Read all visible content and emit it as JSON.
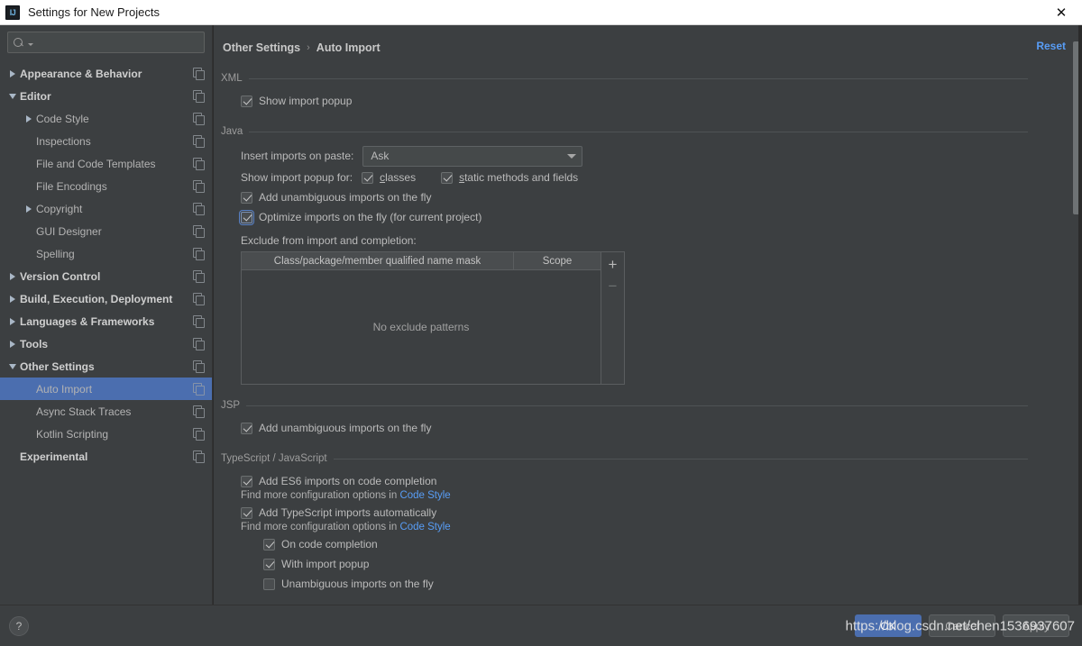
{
  "window": {
    "title": "Settings for New Projects",
    "app_icon": "intellij-idea-icon",
    "close_icon": "close-icon"
  },
  "sidebar": {
    "search": {
      "placeholder": "",
      "value": "",
      "icon": "search-icon"
    },
    "items": [
      {
        "label": "Appearance & Behavior",
        "level": 0,
        "twisty": "closed",
        "selected": false,
        "copy_icon": true
      },
      {
        "label": "Editor",
        "level": 0,
        "twisty": "open",
        "selected": false,
        "copy_icon": true
      },
      {
        "label": "Code Style",
        "level": 1,
        "twisty": "closed",
        "selected": false,
        "copy_icon": true
      },
      {
        "label": "Inspections",
        "level": 1,
        "twisty": "none",
        "selected": false,
        "copy_icon": true
      },
      {
        "label": "File and Code Templates",
        "level": 1,
        "twisty": "none",
        "selected": false,
        "copy_icon": true
      },
      {
        "label": "File Encodings",
        "level": 1,
        "twisty": "none",
        "selected": false,
        "copy_icon": true
      },
      {
        "label": "Copyright",
        "level": 1,
        "twisty": "closed",
        "selected": false,
        "copy_icon": true
      },
      {
        "label": "GUI Designer",
        "level": 1,
        "twisty": "none",
        "selected": false,
        "copy_icon": true
      },
      {
        "label": "Spelling",
        "level": 1,
        "twisty": "none",
        "selected": false,
        "copy_icon": true
      },
      {
        "label": "Version Control",
        "level": 0,
        "twisty": "closed",
        "selected": false,
        "copy_icon": true
      },
      {
        "label": "Build, Execution, Deployment",
        "level": 0,
        "twisty": "closed",
        "selected": false,
        "copy_icon": true
      },
      {
        "label": "Languages & Frameworks",
        "level": 0,
        "twisty": "closed",
        "selected": false,
        "copy_icon": true
      },
      {
        "label": "Tools",
        "level": 0,
        "twisty": "closed",
        "selected": false,
        "copy_icon": true
      },
      {
        "label": "Other Settings",
        "level": 0,
        "twisty": "open",
        "selected": false,
        "copy_icon": true
      },
      {
        "label": "Auto Import",
        "level": 1,
        "twisty": "none",
        "selected": true,
        "copy_icon": true
      },
      {
        "label": "Async Stack Traces",
        "level": 1,
        "twisty": "none",
        "selected": false,
        "copy_icon": true
      },
      {
        "label": "Kotlin Scripting",
        "level": 1,
        "twisty": "none",
        "selected": false,
        "copy_icon": true
      },
      {
        "label": "Experimental",
        "level": 0,
        "twisty": "none",
        "selected": false,
        "copy_icon": true
      }
    ]
  },
  "main": {
    "breadcrumb": {
      "root": "Other Settings",
      "separator": "›",
      "leaf": "Auto Import"
    },
    "reset_label": "Reset",
    "sections": {
      "xml": {
        "title": "XML",
        "show_import_popup": {
          "label": "Show import popup",
          "checked": true
        }
      },
      "java": {
        "title": "Java",
        "insert_imports_label": "Insert imports on paste:",
        "insert_imports_value": "Ask",
        "show_popup_for_label": "Show import popup for:",
        "classes": {
          "label": "classes",
          "mnemonic": "c",
          "checked": true
        },
        "static_methods": {
          "label": "static methods and fields",
          "mnemonic": "s",
          "checked": true
        },
        "add_unambiguous": {
          "label": "Add unambiguous imports on the fly",
          "checked": true
        },
        "optimize_imports": {
          "label": "Optimize imports on the fly (for current project)",
          "checked": true,
          "focused": true
        },
        "exclude_label": "Exclude from import and completion:",
        "table": {
          "columns": [
            "Class/package/member qualified name mask",
            "Scope"
          ],
          "rows": [],
          "empty_text": "No exclude patterns",
          "add_button": "+",
          "remove_button": "−"
        }
      },
      "jsp": {
        "title": "JSP",
        "add_unambiguous": {
          "label": "Add unambiguous imports on the fly",
          "checked": true
        }
      },
      "ts_js": {
        "title": "TypeScript / JavaScript",
        "add_es6": {
          "label": "Add ES6 imports on code completion",
          "checked": true
        },
        "hint_prefix": "Find more configuration options in ",
        "hint_link": "Code Style",
        "add_ts": {
          "label": "Add TypeScript imports automatically",
          "checked": true
        },
        "on_code_completion": {
          "label": "On code completion",
          "checked": true
        },
        "with_import_popup": {
          "label": "With import popup",
          "checked": true
        },
        "unambiguous_on_fly": {
          "label": "Unambiguous imports on the fly",
          "checked": false
        }
      }
    }
  },
  "bottom": {
    "help_label": "?",
    "ok_label": "OK",
    "cancel_label": "Cancel",
    "apply_label": "Apply"
  },
  "watermark": "https://blog.csdn.net/chen1536937607",
  "colors": {
    "accent_blue": "#4b6eaf",
    "link_blue": "#589df6",
    "panel_bg": "#3c3f41",
    "text": "#bbbbbb"
  }
}
